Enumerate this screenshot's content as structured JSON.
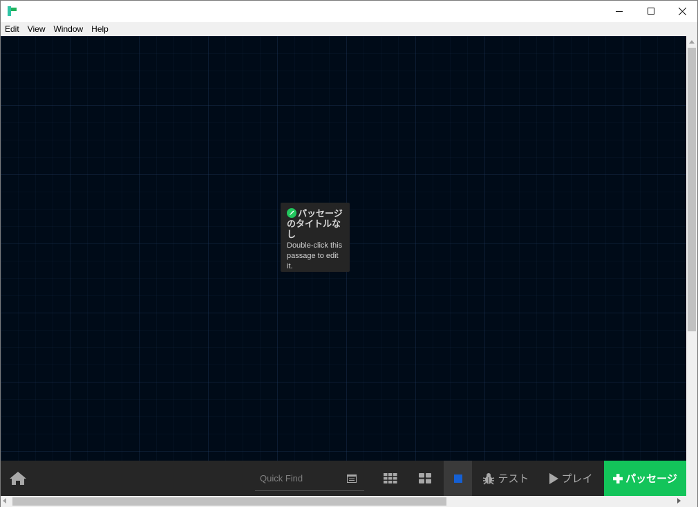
{
  "window": {
    "controls": {
      "minimize_icon": "minimize-icon",
      "maximize_icon": "maximize-icon",
      "close_icon": "close-icon"
    }
  },
  "menu": {
    "items": [
      "Edit",
      "View",
      "Window",
      "Help"
    ]
  },
  "passage": {
    "title": "パッセージのタイトルなし",
    "excerpt": "Double-click this passage to edit it.",
    "icon": "rocket-icon",
    "icon_color": "#21c55d"
  },
  "toolbar": {
    "home_icon": "home-icon",
    "quick_find_placeholder": "Quick Find",
    "test_label": "テスト",
    "play_label": "プレイ",
    "add_label": "パッセージ",
    "add_color": "#13c45a"
  },
  "colors": {
    "canvas_bg": "#000b18",
    "toolbar_bg": "#262626",
    "selected_square": "#1560d4"
  }
}
